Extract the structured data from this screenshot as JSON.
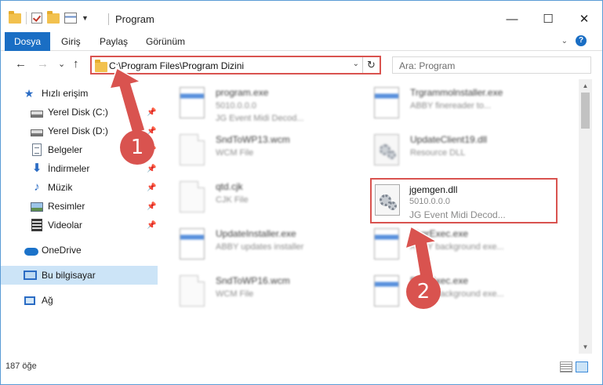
{
  "window": {
    "title": "Program",
    "controls": {
      "minimize": "—",
      "maximize": "☐",
      "close": "✕"
    }
  },
  "ribbon": {
    "tabs": [
      {
        "label": "Dosya"
      },
      {
        "label": "Giriş"
      },
      {
        "label": "Paylaş"
      },
      {
        "label": "Görünüm"
      }
    ],
    "help": "?"
  },
  "nav": {
    "back": "←",
    "forward": "→",
    "recent": "⌄",
    "up": "↑",
    "address": "C:\\Program Files\\Program Dizini",
    "refresh": "↻",
    "search_placeholder": "Ara: Program"
  },
  "sidebar": {
    "items": [
      {
        "label": "Hızlı erişim",
        "icon": "star-icon"
      },
      {
        "label": "Yerel Disk (C:)",
        "icon": "drive-icon",
        "pinned": true
      },
      {
        "label": "Yerel Disk (D:)",
        "icon": "drive-icon",
        "pinned": true
      },
      {
        "label": "Belgeler",
        "icon": "documents-icon",
        "pinned": true
      },
      {
        "label": "İndirmeler",
        "icon": "downloads-icon",
        "pinned": true
      },
      {
        "label": "Müzik",
        "icon": "music-icon",
        "pinned": true
      },
      {
        "label": "Resimler",
        "icon": "pictures-icon",
        "pinned": true
      },
      {
        "label": "Videolar",
        "icon": "videos-icon",
        "pinned": true
      },
      {
        "label": "OneDrive",
        "icon": "onedrive-icon"
      },
      {
        "label": "Bu bilgisayar",
        "icon": "this-pc-icon",
        "selected": true
      },
      {
        "label": "Ağ",
        "icon": "network-icon"
      }
    ]
  },
  "files": [
    {
      "name": "program.exe",
      "line1": "5010.0.0.0",
      "line2": "JG Event Midi Decod...",
      "kind": "app"
    },
    {
      "name": "Trgrammolnstaller.exe",
      "line1": "ABBY finereader to...",
      "line2": "",
      "kind": "app"
    },
    {
      "name": "SndToWP13.wcm",
      "line1": "WCM File",
      "line2": "",
      "kind": "generic"
    },
    {
      "name": "UpdateClient19.dll",
      "line1": "Resource DLL",
      "line2": "",
      "kind": "gear"
    },
    {
      "name": "qtd.cjk",
      "line1": "CJK File",
      "line2": "",
      "kind": "generic"
    },
    {
      "name": "jgemgen.dll",
      "line1": "5010.0.0.0",
      "line2": "JG Event Midi Decod...",
      "kind": "gear"
    },
    {
      "name": "UpdateInstaller.exe",
      "line1": "ABBY updates installer",
      "line2": "",
      "kind": "app"
    },
    {
      "name": "BkgrExec.exe",
      "line1": "ABBY background exe...",
      "line2": "",
      "kind": "app"
    },
    {
      "name": "SndToWP16.wcm",
      "line1": "WCM File",
      "line2": "",
      "kind": "generic"
    },
    {
      "name": "BkgrExec.exe",
      "line1": "ABBY background exe...",
      "line2": "",
      "kind": "app"
    }
  ],
  "status": {
    "count": "187 öğe"
  },
  "annotations": {
    "marker1": "1",
    "marker2": "2"
  },
  "colors": {
    "accent": "#1a6ec4",
    "highlight": "#d9534f",
    "selected": "#cce4f7"
  }
}
